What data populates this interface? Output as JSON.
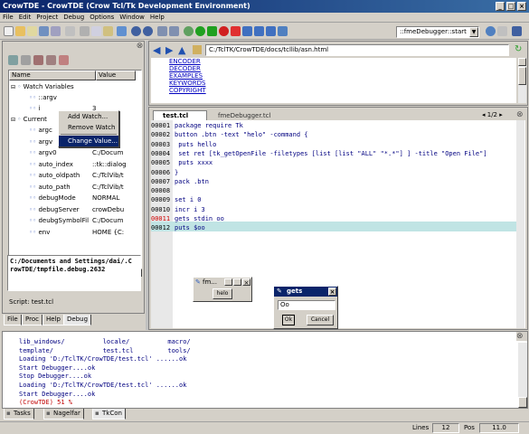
{
  "window": {
    "title": "CrowTDE - CrowTDE (Crow Tcl/Tk Development Environment)"
  },
  "menu": [
    "File",
    "Edit",
    "Project",
    "Debug",
    "Options",
    "Window",
    "Help"
  ],
  "toolbar": {
    "debugger_select": "::fmeDebugger::start"
  },
  "browser": {
    "path": "C:/TclTK/CrowTDE/docs/tcllib/asn.html",
    "links": [
      "ENCODER",
      "DECODER",
      "EXAMPLES",
      "KEYWORDS",
      "COPYRIGHT"
    ]
  },
  "tree": {
    "col_name": "Name",
    "col_value": "Value",
    "watch_group": "Watch Variables",
    "watch_items": [
      {
        "name": "::argv",
        "value": ""
      },
      {
        "name": "i",
        "value": "3"
      }
    ],
    "current_group": "Current",
    "current_items": [
      {
        "name": "argc",
        "value": ""
      },
      {
        "name": "argv",
        "value": ""
      },
      {
        "name": "argv0",
        "value": "C:/Docum"
      },
      {
        "name": "auto_index",
        "value": "::tk::dialog"
      },
      {
        "name": "auto_oldpath",
        "value": "C:/TclVib/t"
      },
      {
        "name": "auto_path",
        "value": "C:/TclVib/t"
      },
      {
        "name": "debugMode",
        "value": "NORMAL"
      },
      {
        "name": "debugServer",
        "value": "crowDebu"
      },
      {
        "name": "deubgSymbolFil",
        "value": "C:/Docum"
      },
      {
        "name": "env",
        "value": "HOME {C:"
      }
    ]
  },
  "context_menu": [
    "Add Watch...",
    "Remove Watch",
    "Change Value..."
  ],
  "info": {
    "text1": "C:/Documents and Settings/dai/.C",
    "text2": "rowTDE/tmpfile.debug.2632",
    "script_label": "Script: test.tcl"
  },
  "left_tabs": [
    "File",
    "Proc",
    "Help",
    "Debug"
  ],
  "editor": {
    "tabs": [
      "test.tcl",
      "fmeDebugger.tcl"
    ],
    "page_indicator": "1/2",
    "lines": [
      {
        "num": "00001",
        "text": "package require Tk"
      },
      {
        "num": "00002",
        "text": "button .btn -text \"helo\" -command {"
      },
      {
        "num": "00003",
        "text": "    puts hello"
      },
      {
        "num": "00004",
        "text": "    set ret [tk_getOpenFile -filetypes [list [list \"ALL\" \"*.*\"] ] -title \"Open File\"]"
      },
      {
        "num": "00005",
        "text": "    puts xxxx"
      },
      {
        "num": "00006",
        "text": "}"
      },
      {
        "num": "00007",
        "text": "pack .btn"
      },
      {
        "num": "00008",
        "text": ""
      },
      {
        "num": "00009",
        "text": "set i 0"
      },
      {
        "num": "00010",
        "text": "incr i 3"
      },
      {
        "num": "00011",
        "text": "gets stdin oo"
      },
      {
        "num": "00012",
        "text": "puts $oo"
      }
    ]
  },
  "mini_window": {
    "title": "fm...",
    "button": "helo"
  },
  "gets_dialog": {
    "title": "gets",
    "input": "Oo",
    "ok": "Ok",
    "cancel": "Cancel"
  },
  "console": {
    "lines": [
      "lib_windows/          locale/          macro/",
      "template/             test.tcl         tools/",
      "Loading 'D:/TclTK/CrowTDE/test.tcl' ......ok",
      "Start Debugger....ok",
      "Stop Debugger....ok",
      "Loading 'D:/TclTK/CrowTDE/test.tcl' ......ok",
      "Start Debugger....ok",
      "(CrowTDE) 51 %"
    ]
  },
  "bottom_tabs": [
    "Tasks",
    "Nagelfar",
    "TkCon"
  ],
  "status": {
    "lines_label": "Lines",
    "lines_value": "12",
    "pos_label": "Pos",
    "pos_value": "11.0"
  }
}
